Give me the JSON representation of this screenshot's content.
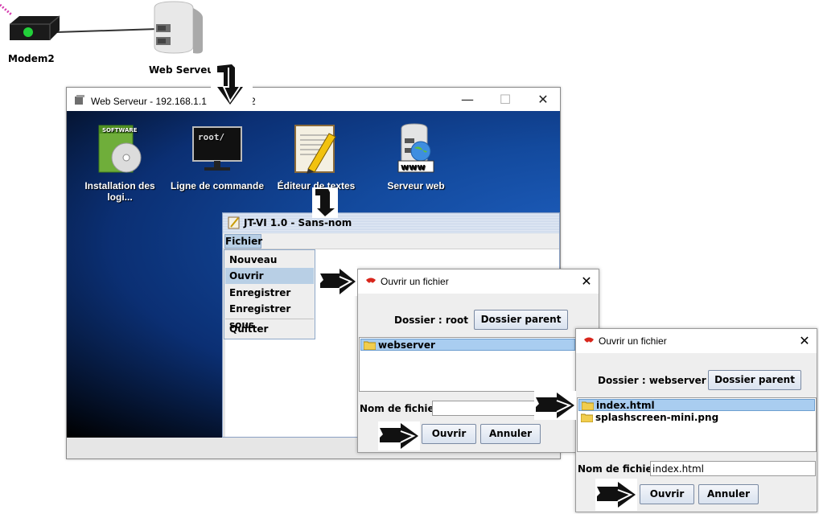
{
  "network": {
    "modem_label": "Modem2",
    "server_label": "Web Serveur"
  },
  "main_window": {
    "title": "Web Serveur - 192.168.1.1",
    "title_tail": "2",
    "minimize": "—",
    "maximize": "☐",
    "close": "✕"
  },
  "desktop": {
    "icons": [
      {
        "label": "Installation des logi...",
        "icon": "software-install-icon"
      },
      {
        "label": "Ligne de commande",
        "icon": "terminal-icon"
      },
      {
        "label": "Éditeur de textes",
        "icon": "text-editor-icon"
      },
      {
        "label": "Serveur web",
        "icon": "web-server-icon"
      }
    ],
    "terminal_text": "root/"
  },
  "editor": {
    "title": "JT-VI 1.0 - Sans-nom",
    "menu": "Fichier",
    "menu_items": [
      "Nouveau",
      "Ouvrir",
      "Enregistrer",
      "Enregistrer sous",
      "Quitter"
    ],
    "highlighted_item": "Ouvrir"
  },
  "dialog1": {
    "title": "Ouvrir un fichier",
    "folder_label": "Dossier : root",
    "parent_button": "Dossier parent",
    "files": [
      "webserver"
    ],
    "selected_file": "webserver",
    "filename_label": "Nom de fichier :",
    "filename_value": "",
    "open_button": "Ouvrir",
    "cancel_button": "Annuler"
  },
  "dialog2": {
    "title": "Ouvrir un fichier",
    "folder_label": "Dossier : webserver",
    "parent_button": "Dossier parent",
    "files": [
      "index.html",
      "splashscreen-mini.png"
    ],
    "selected_file": "index.html",
    "filename_label": "Nom de fichier :",
    "filename_value": "index.html",
    "open_button": "Ouvrir",
    "cancel_button": "Annuler"
  },
  "colors": {
    "selection": "#a9cdf0",
    "desktop_blue": "#134a9e",
    "menu_highlight": "#b8cfe5"
  }
}
